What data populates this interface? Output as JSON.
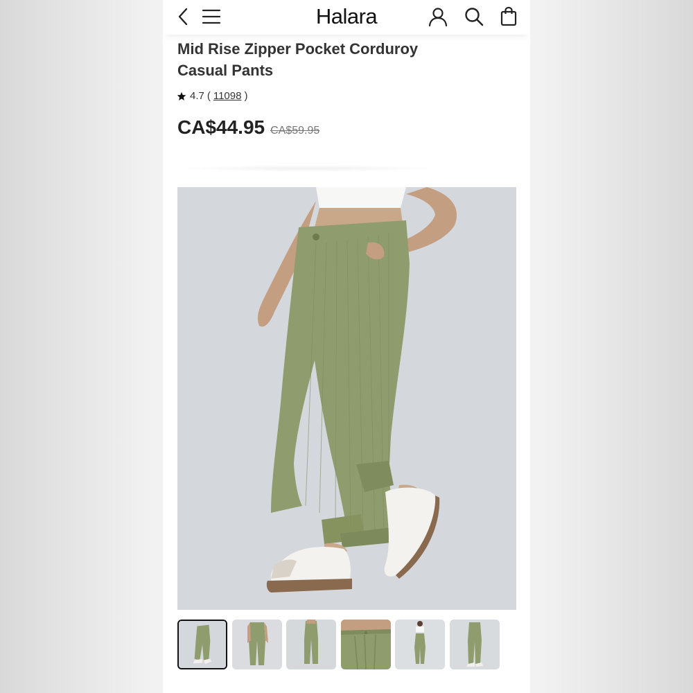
{
  "header": {
    "brand": "Halara",
    "icons": [
      "back-arrow-icon",
      "hamburger-menu-icon",
      "user-account-icon",
      "search-icon",
      "shopping-bag-icon"
    ]
  },
  "product": {
    "title": "Mid Rise Zipper Pocket Corduroy Casual Pants",
    "rating": "4.7",
    "review_open": "(",
    "review_count": "11098",
    "review_close": ")",
    "price": "CA$44.95",
    "original_price": "CA$59.95",
    "color": "#8f9c6e"
  },
  "gallery": {
    "thumbnail_count": 6,
    "selected_index": 0
  }
}
